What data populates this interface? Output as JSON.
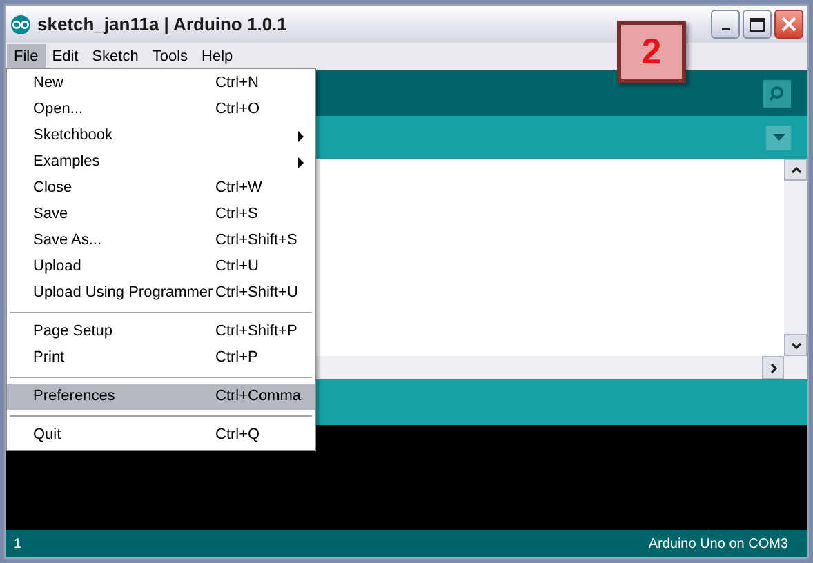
{
  "window": {
    "title": "sketch_jan11a | Arduino 1.0.1"
  },
  "menu_bar": [
    {
      "label": "File",
      "selected": true
    },
    {
      "label": "Edit",
      "selected": false
    },
    {
      "label": "Sketch",
      "selected": false
    },
    {
      "label": "Tools",
      "selected": false
    },
    {
      "label": "Help",
      "selected": false
    }
  ],
  "file_menu": [
    {
      "kind": "item",
      "label": "New",
      "shortcut": "Ctrl+N",
      "selected": false
    },
    {
      "kind": "item",
      "label": "Open...",
      "shortcut": "Ctrl+O",
      "selected": false
    },
    {
      "kind": "submenu",
      "label": "Sketchbook",
      "selected": false
    },
    {
      "kind": "submenu",
      "label": "Examples",
      "selected": false
    },
    {
      "kind": "item",
      "label": "Close",
      "shortcut": "Ctrl+W",
      "selected": false
    },
    {
      "kind": "item",
      "label": "Save",
      "shortcut": "Ctrl+S",
      "selected": false
    },
    {
      "kind": "item",
      "label": "Save As...",
      "shortcut": "Ctrl+Shift+S",
      "selected": false
    },
    {
      "kind": "item",
      "label": "Upload",
      "shortcut": "Ctrl+U",
      "selected": false
    },
    {
      "kind": "item",
      "label": "Upload Using Programmer",
      "shortcut": "Ctrl+Shift+U",
      "selected": false
    },
    {
      "kind": "separator"
    },
    {
      "kind": "item",
      "label": "Page Setup",
      "shortcut": "Ctrl+Shift+P",
      "selected": false
    },
    {
      "kind": "item",
      "label": "Print",
      "shortcut": "Ctrl+P",
      "selected": false
    },
    {
      "kind": "separator"
    },
    {
      "kind": "item",
      "label": "Preferences",
      "shortcut": "Ctrl+Comma",
      "selected": true
    },
    {
      "kind": "separator"
    },
    {
      "kind": "item",
      "label": "Quit",
      "shortcut": "Ctrl+Q",
      "selected": false
    }
  ],
  "step_badge": "2",
  "status_bar": {
    "line": "1",
    "board": "Arduino Uno on COM3"
  }
}
